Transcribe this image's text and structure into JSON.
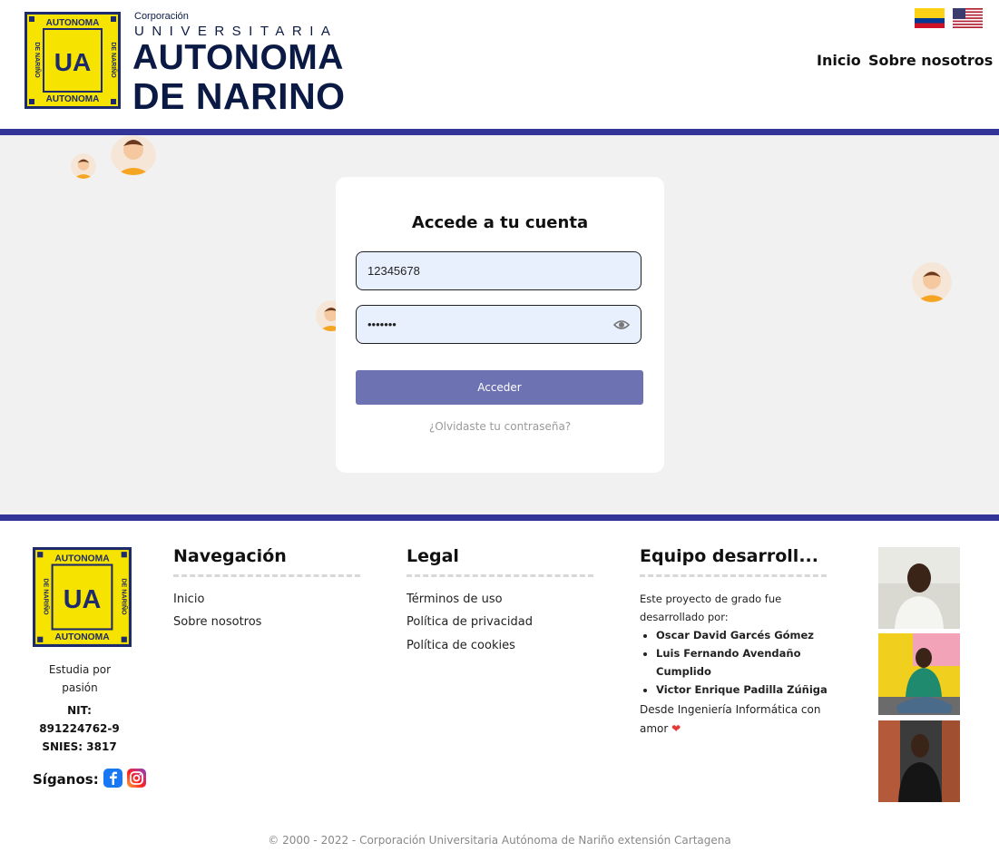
{
  "header": {
    "logo_text_top": "AUTONOMA",
    "logo_text_bottom": "AUTONOMA",
    "logo_text_side": "DE NARIÑO",
    "logo_monogram": "UA",
    "brand_line1": "Corporación",
    "brand_line2": "UNIVERSITARIA",
    "brand_line3": "AUTONOMA",
    "brand_line4": "DE NARINO",
    "nav": [
      "Inicio",
      "Sobre nosotros"
    ],
    "flags": [
      "colombia-flag-icon",
      "usa-flag-icon"
    ]
  },
  "login": {
    "title": "Accede a tu cuenta",
    "username_value": "12345678",
    "password_value": "•••••••",
    "submit_label": "Acceder",
    "forgot_label": "¿Olvidaste tu contraseña?"
  },
  "footer": {
    "logo_text_top": "AUTONOMA",
    "logo_text_bottom": "AUTONOMA",
    "logo_text_side": "DE NARIÑO",
    "logo_monogram": "UA",
    "slogan": "Estudia por pasión",
    "nit_label": "NIT:",
    "nit_value": "891224762-9",
    "snies": "SNIES: 3817",
    "follow_label": "Síganos:",
    "nav_title": "Navegación",
    "nav_links": [
      "Inicio",
      "Sobre nosotros"
    ],
    "legal_title": "Legal",
    "legal_links": [
      "Términos de uso",
      "Política de privacidad",
      "Política de cookies"
    ],
    "team_title": "Equipo desarroll...",
    "team_intro": "Este proyecto de grado fue desarrollado por:",
    "team_members": [
      "Oscar David Garcés Gómez",
      "Luis Fernando Avendaño Cumplido",
      "Victor Enrique Padilla Zúñiga"
    ],
    "team_outro": "Desde Ingeniería Informática con amor",
    "copyright": "© 2000 - 2022 - Corporación Universitaria Autónoma de Nariño extensión Cartagena"
  },
  "colors": {
    "brand_navy": "#0b1a45",
    "band_blue": "#323597",
    "button": "#6c72b2",
    "logo_yellow": "#f7e300"
  }
}
